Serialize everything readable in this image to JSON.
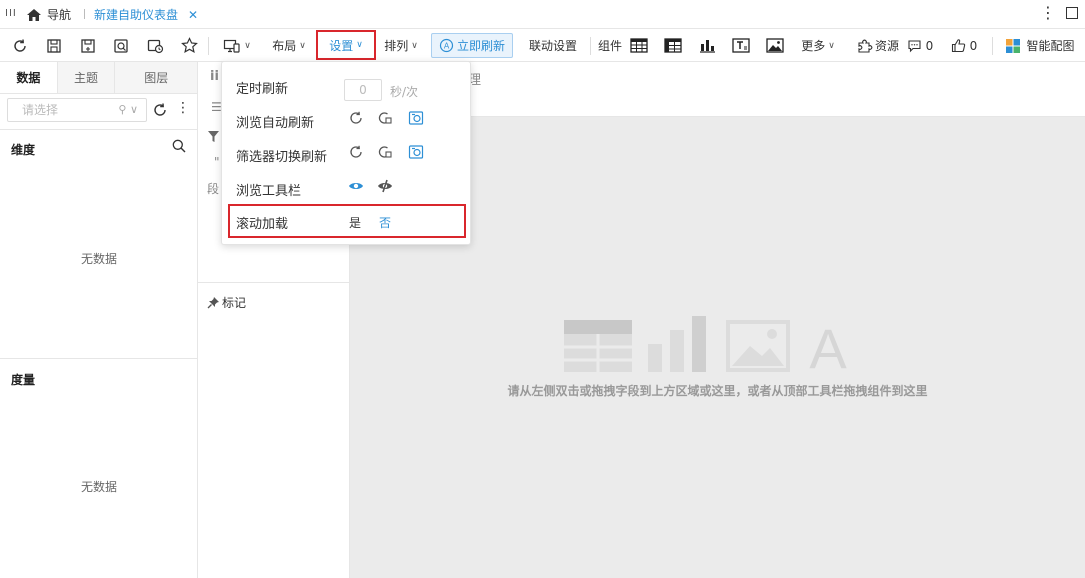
{
  "tabbar": {
    "nav_label": "导航",
    "tab_title": "新建自助仪表盘"
  },
  "toolbar": {
    "layout_label": "布局",
    "settings_label": "设置",
    "arrange_label": "排列",
    "refresh_now_label": "立即刷新",
    "linkage_label": "联动设置",
    "component_label": "组件",
    "more_label": "更多",
    "resources_label": "资源",
    "comments_count": "0",
    "likes_count": "0",
    "smart_chart_label": "智能配图"
  },
  "left_panel": {
    "tabs": [
      "数据",
      "主题",
      "图层"
    ],
    "search_placeholder": "请选择",
    "dimension_title": "维度",
    "measure_title": "度量",
    "no_data": "无数据"
  },
  "mid_panel": {
    "seg_text": "段",
    "quote_text": "\"",
    "mark_label": "标记",
    "top_suffix": "理"
  },
  "canvas": {
    "hint": "请从左侧双击或拖拽字段到上方区域或这里，或者从顶部工具栏拖拽组件到这里"
  },
  "settings_dropdown": {
    "timed_refresh_label": "定时刷新",
    "timed_refresh_value": "0",
    "timed_refresh_unit": "秒/次",
    "browse_auto_refresh_label": "浏览自动刷新",
    "filter_switch_refresh_label": "筛选器切换刷新",
    "browse_toolbar_label": "浏览工具栏",
    "scroll_load_label": "滚动加载",
    "scroll_load_yes": "是",
    "scroll_load_no": "否",
    "scroll_load_selected": "否"
  },
  "colors": {
    "accent": "#2d8fd5",
    "highlight_border": "#d9262c",
    "canvas_bg": "#ebebeb"
  }
}
